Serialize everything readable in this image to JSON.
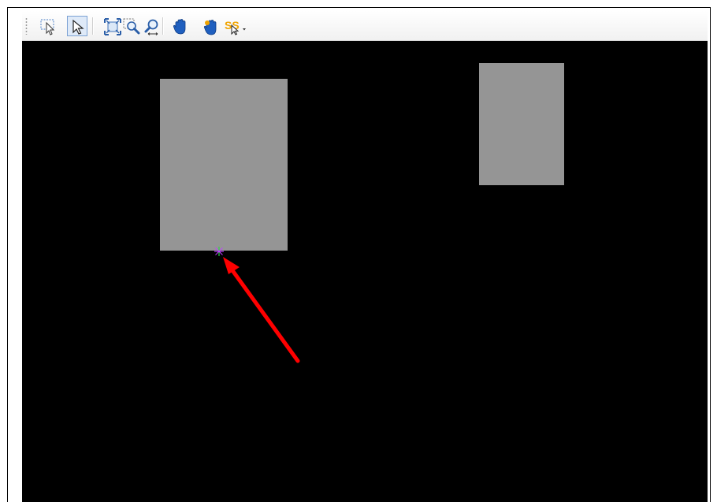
{
  "toolbar": {
    "buttons": [
      {
        "name": "select-region-tool",
        "icon": "dashed-select-arrow-icon",
        "active": false
      },
      {
        "name": "select-pointer-tool",
        "icon": "pointer-arrow-icon",
        "active": true
      },
      {
        "name": "zoom-extents-tool",
        "icon": "zoom-extents-icon",
        "active": false
      },
      {
        "name": "zoom-window-tool",
        "icon": "zoom-window-icon",
        "active": false
      },
      {
        "name": "zoom-realtime-tool",
        "icon": "zoom-realtime-icon",
        "active": false
      },
      {
        "name": "pan-tool",
        "icon": "hand-pan-icon",
        "active": false
      },
      {
        "name": "pan-realtime-tool",
        "icon": "hand-pan-realtime-icon",
        "active": false
      },
      {
        "name": "snap-tool",
        "icon": "snap-dropdown-icon",
        "active": false
      }
    ]
  },
  "colors": {
    "canvas_background": "#000000",
    "shape_fill": "#959595",
    "annotation_arrow": "#ff0000",
    "toolbar_active": "#dfeaf8",
    "icon_blue": "#1f5fbf",
    "icon_orange": "#f0a400"
  },
  "canvas": {
    "shapes": [
      {
        "name": "gray-rectangle-left"
      },
      {
        "name": "gray-rectangle-right"
      }
    ],
    "marker": {
      "name": "snap-point-marker",
      "icon": "crosshair-star-icon"
    },
    "annotation": {
      "name": "red-annotation-arrow",
      "points_to": "snap-point-marker"
    }
  }
}
